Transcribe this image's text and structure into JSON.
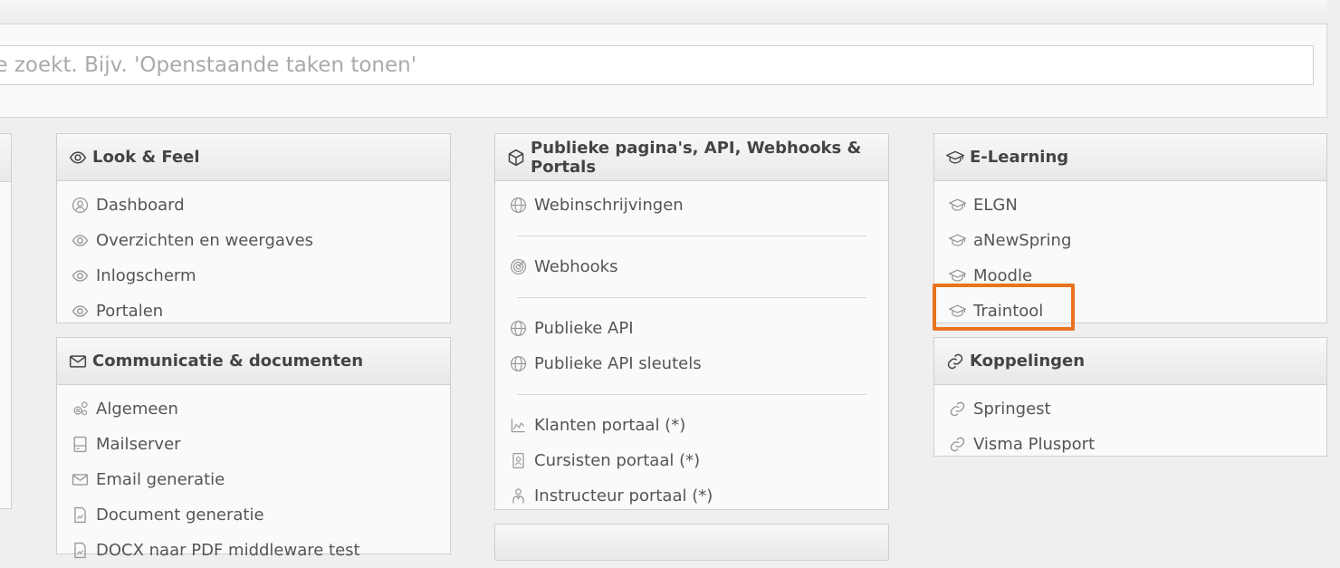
{
  "search": {
    "placeholder": "je zoekt. Bijv. 'Openstaande taken tonen'"
  },
  "look_feel": {
    "title": "Look & Feel",
    "items": [
      "Dashboard",
      "Overzichten en weergaves",
      "Inlogscherm",
      "Portalen"
    ]
  },
  "communicatie": {
    "title": "Communicatie & documenten",
    "items": [
      "Algemeen",
      "Mailserver",
      "Email generatie",
      "Document generatie",
      "DOCX naar PDF middleware test"
    ]
  },
  "publiek": {
    "title": "Publieke pagina's, API, Webhooks & Portals",
    "items": [
      "Webinschrijvingen",
      "Webhooks",
      "Publieke API",
      "Publieke API sleutels",
      "Klanten portaal (*)",
      "Cursisten portaal (*)",
      "Instructeur portaal (*)"
    ]
  },
  "elearning": {
    "title": "E-Learning",
    "items": [
      "ELGN",
      "aNewSpring",
      "Moodle",
      "Traintool"
    ]
  },
  "koppelingen": {
    "title": "Koppelingen",
    "items": [
      "Springest",
      "Visma Plusport"
    ]
  },
  "colors": {
    "highlight": "#e8731f",
    "panel": "#fafafa",
    "border": "#cfcfcf"
  }
}
